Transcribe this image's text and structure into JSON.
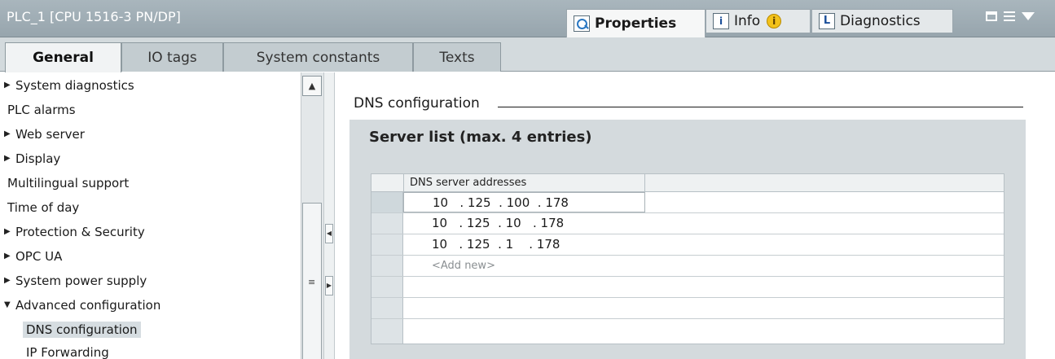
{
  "window": {
    "title": "PLC_1 [CPU 1516-3 PN/DP]",
    "tabs": [
      {
        "label": "Properties",
        "icon": "properties-icon",
        "active": true
      },
      {
        "label": "Info",
        "icon": "info-icon",
        "active": false,
        "badge": "i"
      },
      {
        "label": "Diagnostics",
        "icon": "diagnostics-icon",
        "active": false
      }
    ],
    "info_icon_glyph": "i",
    "diag_icon_glyph": "L"
  },
  "subtabs": [
    {
      "label": "General",
      "active": true
    },
    {
      "label": "IO tags",
      "active": false
    },
    {
      "label": "System constants",
      "active": false
    },
    {
      "label": "Texts",
      "active": false
    }
  ],
  "nav": {
    "items": [
      {
        "label": "System diagnostics",
        "expandable": true,
        "expanded": false,
        "indent": 0
      },
      {
        "label": "PLC alarms",
        "expandable": false,
        "indent": 0
      },
      {
        "label": "Web server",
        "expandable": true,
        "expanded": false,
        "indent": 0
      },
      {
        "label": "Display",
        "expandable": true,
        "expanded": false,
        "indent": 0
      },
      {
        "label": "Multilingual support",
        "expandable": false,
        "indent": 0
      },
      {
        "label": "Time of day",
        "expandable": false,
        "indent": 0
      },
      {
        "label": "Protection & Security",
        "expandable": true,
        "expanded": false,
        "indent": 0
      },
      {
        "label": "OPC UA",
        "expandable": true,
        "expanded": false,
        "indent": 0
      },
      {
        "label": "System power supply",
        "expandable": true,
        "expanded": false,
        "indent": 0
      },
      {
        "label": "Advanced configuration",
        "expandable": true,
        "expanded": true,
        "indent": 0
      },
      {
        "label": "DNS configuration",
        "expandable": false,
        "indent": 1,
        "selected": true
      },
      {
        "label": "IP Forwarding",
        "expandable": false,
        "indent": 1
      }
    ],
    "expanded_arrow": "▼",
    "collapsed_arrow": "▶",
    "scroll_up_glyph": "▲",
    "grip_glyph": "≡",
    "splitter_left_glyph": "◀",
    "splitter_right_glyph": "▶"
  },
  "main": {
    "section_title": "DNS configuration",
    "panel_heading": "Server list (max. 4 entries)",
    "grid": {
      "column_header": "DNS server addresses",
      "rows": [
        "10   . 125  . 100  . 178",
        "10   . 125  . 10   . 178",
        "10   . 125  . 1    . 178"
      ],
      "add_new": "<Add new>"
    }
  },
  "colors": {
    "titlebar": "#a9b6bd",
    "tabstrip": "#d3dadd",
    "panel": "#d4dadd",
    "selection": "#d6dde1",
    "warning": "#f3c21b"
  }
}
